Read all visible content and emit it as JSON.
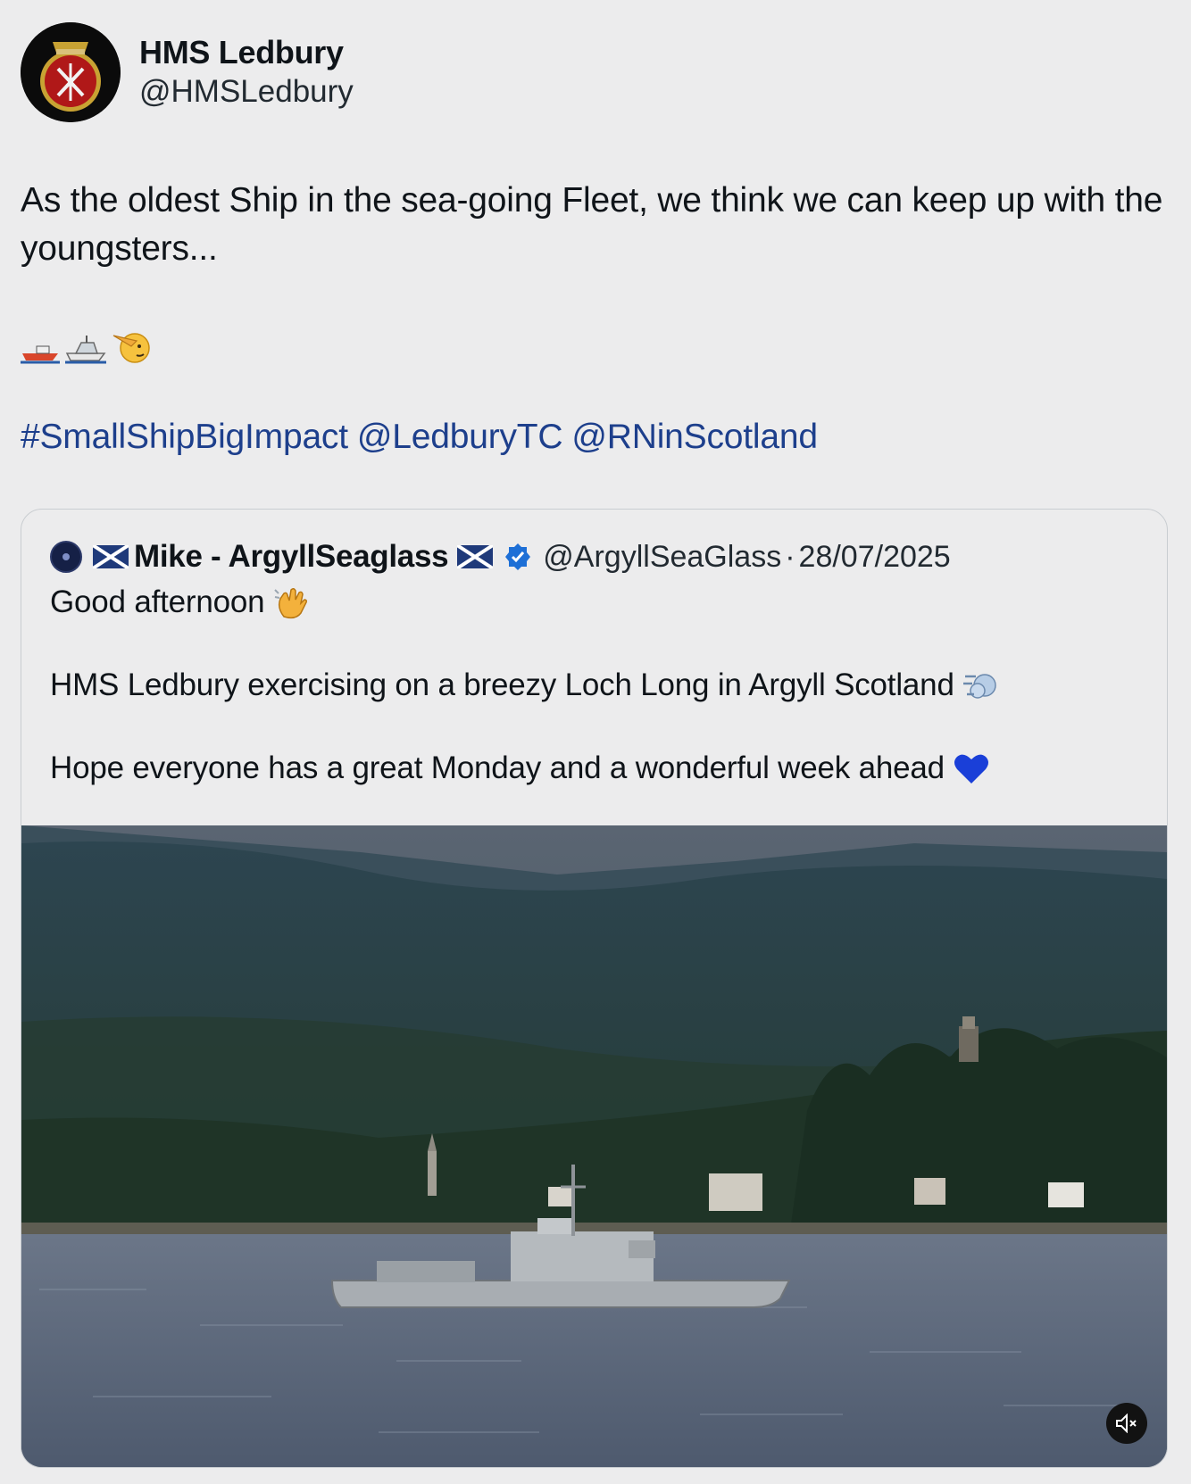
{
  "post": {
    "author_name": "HMS Ledbury",
    "author_handle": "@HMSLedbury",
    "text": "As the oldest Ship in the sea-going Fleet, we think we can keep up with the youngsters...",
    "emojis": [
      "motorboat-icon",
      "speedboat-icon",
      "saluting-face-icon"
    ],
    "hashtags": [
      "#SmallShipBigImpact",
      "@LedburyTC",
      "@RNinScotland"
    ]
  },
  "quote": {
    "author_name": "Mike - ArgyllSeaglass",
    "author_handle": "@ArgyllSeaGlass",
    "separator": "·",
    "date": "28/07/2025",
    "lines": [
      "Good afternoon",
      "HMS Ledbury exercising on a breezy Loch Long in Argyll Scotland",
      "Hope everyone has a great Monday and a wonderful week ahead"
    ],
    "media_icons": [
      "mute-icon"
    ],
    "colors": {
      "verified": "#1d6fd6",
      "link": "#1d3f8c",
      "heart": "#1a3fd8"
    }
  }
}
